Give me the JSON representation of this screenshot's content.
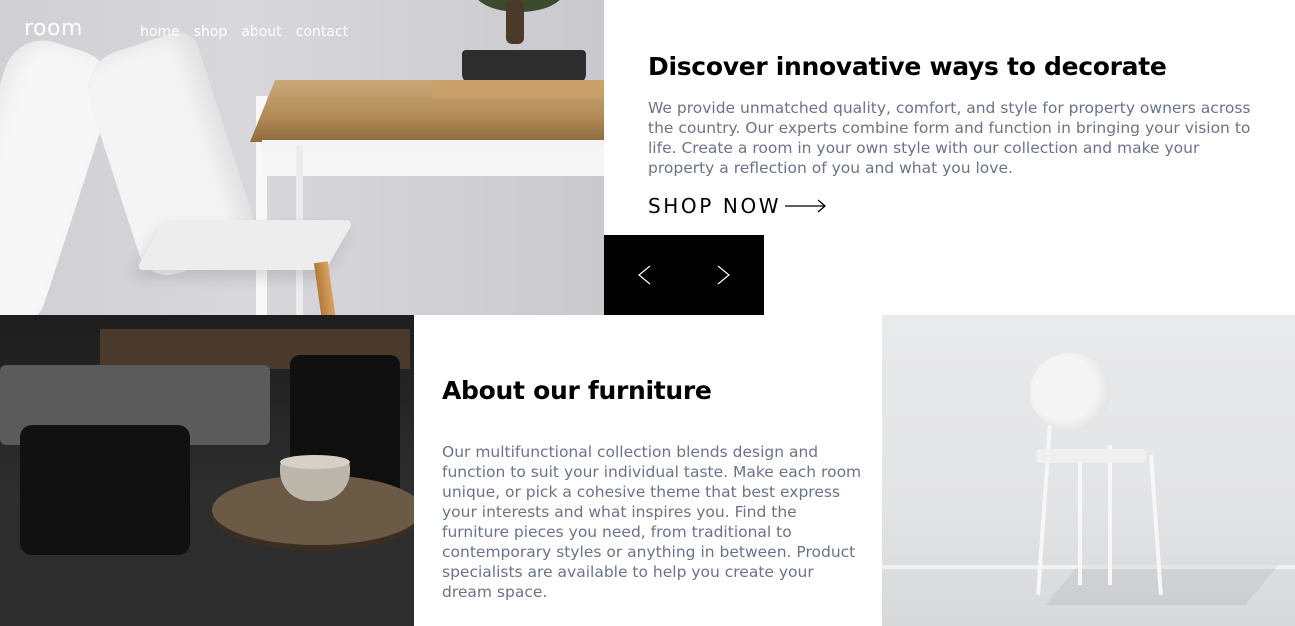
{
  "header": {
    "logo": "room",
    "nav": [
      "home",
      "shop",
      "about",
      "contact"
    ]
  },
  "hero": {
    "title": "Discover innovative ways to decorate",
    "text": "We provide unmatched quality, comfort, and style for property owners across the country. Our experts combine form and function in bringing your vision to life. Create a room in your own style with our collection and make your property a reflection of you and what you love.",
    "cta_label": "SHOP NOW",
    "cta_icon": "arrow-right-icon"
  },
  "slider": {
    "prev_icon": "chevron-left-icon",
    "next_icon": "chevron-right-icon"
  },
  "about": {
    "title": "About our furniture",
    "text": "Our multifunctional collection blends design and function to suit your individual taste. Make each room unique, or pick a cohesive theme that best express your interests and what inspires you. Find the furniture pieces you need, from traditional to contemporary styles or anything in between. Product specialists are available to help you create your dream space."
  },
  "colors": {
    "heading": "#000000",
    "body_text": "#6b7487",
    "slider_bg": "#000000",
    "nav_text": "#ffffff"
  }
}
